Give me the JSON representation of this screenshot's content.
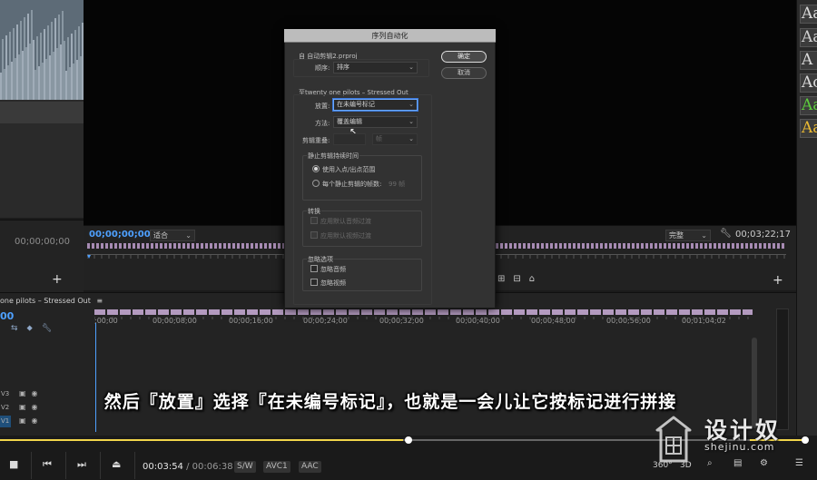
{
  "source_monitor": {
    "timecode": "00;00;00;00",
    "add_label": "+"
  },
  "program_monitor": {
    "timecode": "00;00;00;00",
    "fit": "适合",
    "quality": "完整",
    "duration": "00;03;22;17",
    "add_label": "+"
  },
  "timeline": {
    "sequence_name": "one pilots – Stressed Out",
    "timecode": "00",
    "ruler_labels": [
      ";00;00",
      "00;00;08;00",
      "00;00;16;00",
      "00;00;24;00",
      "00;00;32;00",
      "00;00;40;00",
      "00;00;48;00",
      "00;00;56;00",
      "00;01;04;02"
    ],
    "tracks": [
      {
        "name": "V3"
      },
      {
        "name": "V2"
      },
      {
        "name": "V1"
      }
    ]
  },
  "effects_panel": {
    "swatches": [
      {
        "label": "Aa",
        "color": "#d9d9d9"
      },
      {
        "label": "Aa",
        "color": "#cfcfcf"
      },
      {
        "label": "A",
        "color": "#d9d9d9"
      },
      {
        "label": "Ac",
        "color": "#d9d9d9"
      },
      {
        "label": "Aa",
        "color": "#5ccc3c"
      },
      {
        "label": "Aa",
        "color": "#e8b832"
      }
    ]
  },
  "dialog": {
    "title": "序列自动化",
    "from_label": "自 自动剪辑2.prproj",
    "order_label": "顺序:",
    "order_value": "排序",
    "ok_label": "确定",
    "cancel_label": "取消",
    "to_label": "至twenty one pilots – Stressed Out",
    "placement_label": "放置:",
    "placement_value": "在未编号标记",
    "method_label": "方法:",
    "method_value": "覆盖编辑",
    "clip_overlap_label": "剪辑重叠:",
    "clip_overlap_unit": "帧",
    "still_group_label": "静止剪辑持续时间",
    "still_opt1": "使用入点/出点范围",
    "still_opt2": "每个静止剪辑的帧数:",
    "still_opt2_value": "99 帧",
    "transition_group_label": "转换",
    "transition_audio": "应用默认音频过渡",
    "transition_video": "应用默认视频过渡",
    "ignore_group_label": "忽略选项",
    "ignore_audio": "忽略音频",
    "ignore_video": "忽略视频"
  },
  "caption": "然后『放置』选择『在未编号标记』，也就是一会儿让它按标记进行拼接",
  "watermark": {
    "title": "设计奴",
    "url": "shejinu.com"
  },
  "player": {
    "progress": 0.5,
    "current_time": "00:03:54",
    "separator": "/",
    "total_time": "00:06:38",
    "tags": [
      "S/W",
      "AVC1",
      "AAC"
    ],
    "icons": [
      "360°",
      "3D"
    ]
  },
  "colors": {
    "accent_blue": "#4ea0ff",
    "progress_yellow": "#f2d64a"
  }
}
